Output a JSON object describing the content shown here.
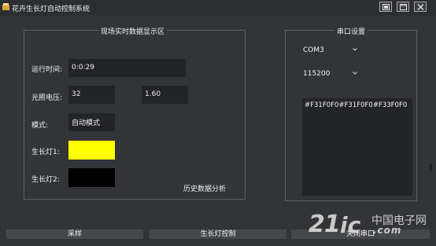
{
  "window": {
    "title": "花卉生长灯自动控制系统"
  },
  "data_panel": {
    "title": "现场实时数据显示区",
    "runtime_label": "运行时间:",
    "runtime_value": "0:0:29",
    "light_voltage_label": "光照电压:",
    "light_voltage_value_1": "32",
    "light_voltage_value_2": "1.60",
    "mode_label": "模式:",
    "mode_value": "自动模式",
    "grow_light_1_label": "生长灯1:",
    "grow_light_1_color": "#ffff00",
    "grow_light_2_label": "生长灯2:",
    "grow_light_2_color": "#000000",
    "history_link": "历史数据分析"
  },
  "serial_panel": {
    "title": "串口设置",
    "port_value": "COM3",
    "baud_value": "115200",
    "received_text": "#F31F0F0#F31F0F0#F33F0F0"
  },
  "bottom_buttons": {
    "sample": "采样",
    "grow_light_control": "生长灯控制",
    "close_serial": "关闭串口"
  },
  "watermark": {
    "number": "21",
    "ic": "ic",
    "cn": "中国电子网",
    "com": ".com"
  },
  "colors": {
    "background": "#323437",
    "field": "#232427",
    "border": "#5e6064"
  },
  "icons": [
    "app-icon",
    "restore-icon",
    "maximize-icon",
    "close-icon",
    "chevron-down-icon"
  ]
}
